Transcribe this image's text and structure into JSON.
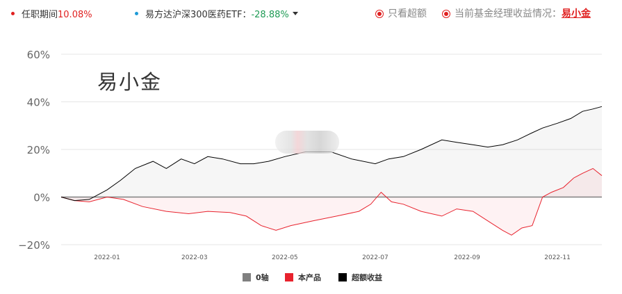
{
  "header": {
    "tenure_label": "任职期间",
    "tenure_value": "10.08%",
    "benchmark_label": "易方达沪深300医药ETF：",
    "benchmark_value": "-28.88%",
    "option_excess_only": "只看超额",
    "option_manager_returns": "当前基金经理收益情况：",
    "manager_name": "易小金",
    "colors": {
      "accent_red": "#e02020",
      "benchmark_blue": "#1e9bd7",
      "negative_green": "#1f9b55"
    }
  },
  "watermark": "易小金",
  "legend": [
    {
      "label": "0轴",
      "color": "#808080"
    },
    {
      "label": "本产品",
      "color": "#e8222d"
    },
    {
      "label": "超额收益",
      "color": "#000000"
    }
  ],
  "chart_data": {
    "type": "line",
    "ylim": [
      -20,
      60
    ],
    "yticks": [
      "60%",
      "40%",
      "20%",
      "0%",
      "−20%"
    ],
    "ytick_values": [
      60,
      40,
      20,
      0,
      -20
    ],
    "xlim": [
      "2021-12-01",
      "2022-12-01"
    ],
    "xticks": [
      "2022-01",
      "2022-03",
      "2022-05",
      "2022-07",
      "2022-09",
      "2022-11"
    ],
    "xtick_dates": [
      "2022-01-01",
      "2022-03-01",
      "2022-05-01",
      "2022-07-01",
      "2022-09-01",
      "2022-11-01"
    ],
    "grid": true,
    "series": [
      {
        "name": "0轴",
        "color": "#808080",
        "x": [
          "2021-12-01",
          "2022-12-01"
        ],
        "values": [
          0,
          0
        ]
      },
      {
        "name": "本产品",
        "color": "#e8222d",
        "x": [
          "2021-12-01",
          "2021-12-10",
          "2021-12-20",
          "2022-01-01",
          "2022-01-12",
          "2022-01-25",
          "2022-02-10",
          "2022-02-25",
          "2022-03-10",
          "2022-03-25",
          "2022-04-05",
          "2022-04-15",
          "2022-04-25",
          "2022-05-05",
          "2022-05-20",
          "2022-06-05",
          "2022-06-20",
          "2022-06-28",
          "2022-07-05",
          "2022-07-12",
          "2022-07-20",
          "2022-08-01",
          "2022-08-15",
          "2022-08-25",
          "2022-09-05",
          "2022-09-15",
          "2022-09-25",
          "2022-10-01",
          "2022-10-08",
          "2022-10-15",
          "2022-10-22",
          "2022-10-28",
          "2022-11-05",
          "2022-11-12",
          "2022-11-18",
          "2022-11-25",
          "2022-12-01"
        ],
        "values": [
          0,
          -1.5,
          -2,
          0,
          -1,
          -4,
          -6,
          -7,
          -6,
          -6.5,
          -8,
          -12,
          -14,
          -12,
          -10,
          -8,
          -6,
          -3,
          2,
          -2,
          -3,
          -6,
          -8,
          -5,
          -6,
          -10,
          -14,
          -16,
          -13,
          -12,
          0,
          2,
          4,
          8,
          10,
          12,
          9
        ]
      },
      {
        "name": "超额收益",
        "color": "#000000",
        "x": [
          "2021-12-01",
          "2021-12-10",
          "2021-12-20",
          "2022-01-01",
          "2022-01-10",
          "2022-01-20",
          "2022-02-01",
          "2022-02-10",
          "2022-02-20",
          "2022-03-01",
          "2022-03-10",
          "2022-03-20",
          "2022-04-01",
          "2022-04-10",
          "2022-04-20",
          "2022-05-01",
          "2022-05-15",
          "2022-06-01",
          "2022-06-15",
          "2022-07-01",
          "2022-07-10",
          "2022-07-20",
          "2022-08-01",
          "2022-08-15",
          "2022-08-25",
          "2022-09-05",
          "2022-09-15",
          "2022-09-25",
          "2022-10-05",
          "2022-10-15",
          "2022-10-22",
          "2022-11-01",
          "2022-11-10",
          "2022-11-18",
          "2022-11-25",
          "2022-12-01"
        ],
        "values": [
          0,
          -1.5,
          -1,
          3,
          7,
          12,
          15,
          12,
          16,
          14,
          17,
          16,
          14,
          14,
          15,
          17,
          19,
          19,
          16,
          14,
          16,
          17,
          20,
          24,
          23,
          22,
          21,
          22,
          24,
          27,
          29,
          31,
          33,
          36,
          37,
          38
        ]
      }
    ]
  }
}
